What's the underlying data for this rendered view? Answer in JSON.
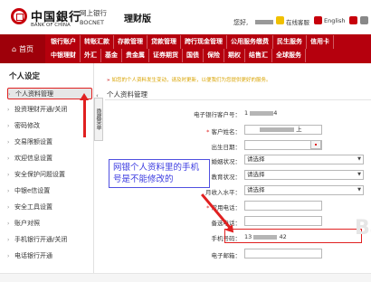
{
  "header": {
    "bank_name_cn": "中国銀行",
    "bank_name_en": "BANK OF CHINA",
    "netbank_cn": "网上银行",
    "netbank_en": "BOCNET",
    "product": "理财版",
    "greeting": "您好,",
    "online_service": "在线客服",
    "english": "English"
  },
  "nav": {
    "home": "首页",
    "row1": [
      "银行账户",
      "转账汇款",
      "存款管理",
      "贷款管理",
      "跨行现金管理",
      "公用服务缴费",
      "民生服务",
      "信用卡"
    ],
    "row2": [
      "中银理财",
      "外汇",
      "基金",
      "贵金属",
      "证券期货",
      "国债",
      "保险",
      "期权",
      "结售汇",
      "全球服务"
    ]
  },
  "sidebar": {
    "title": "个人设定",
    "items": [
      "个人资料管理",
      "投资理财开通/关闭",
      "密码修改",
      "交易限额设置",
      "欢迎信息设置",
      "安全保护问题设置",
      "中银e信设置",
      "安全工具设置",
      "账户对照",
      "手机银行开通/关闭",
      "电话银行开通"
    ],
    "collapse_label": "隐藏菜单"
  },
  "main": {
    "notice": "如您的个人资料发生变动，请及时更新，以便我们为您提供更好的服务。",
    "title": "个人资料管理",
    "fields": {
      "customer_no_label": "电子银行客户号：",
      "customer_no_prefix": "1",
      "customer_no_suffix": "4",
      "name_label": "客户姓名：",
      "name_suffix": "上",
      "birth_label": "出生日期：",
      "marital_label": "婚姻状况：",
      "marital_value": "请选择",
      "education_label": "教育状况：",
      "education_value": "请选择",
      "income_label": "月收入水平：",
      "income_value": "请选择",
      "phone_label": "常用电话：",
      "backup_phone_label": "备选电话：",
      "mobile_label": "手机号码：",
      "mobile_prefix": "13",
      "mobile_suffix": "42",
      "email_label": "电子邮箱："
    }
  },
  "annotation": {
    "text": "网银个人资料里的手机号是不能修改的"
  },
  "watermark": "Ba",
  "colors": {
    "brand_red": "#b5000d",
    "highlight_red": "#e02020",
    "annotation_blue": "#3a3ae0",
    "notice_yellow": "#d9a300"
  }
}
